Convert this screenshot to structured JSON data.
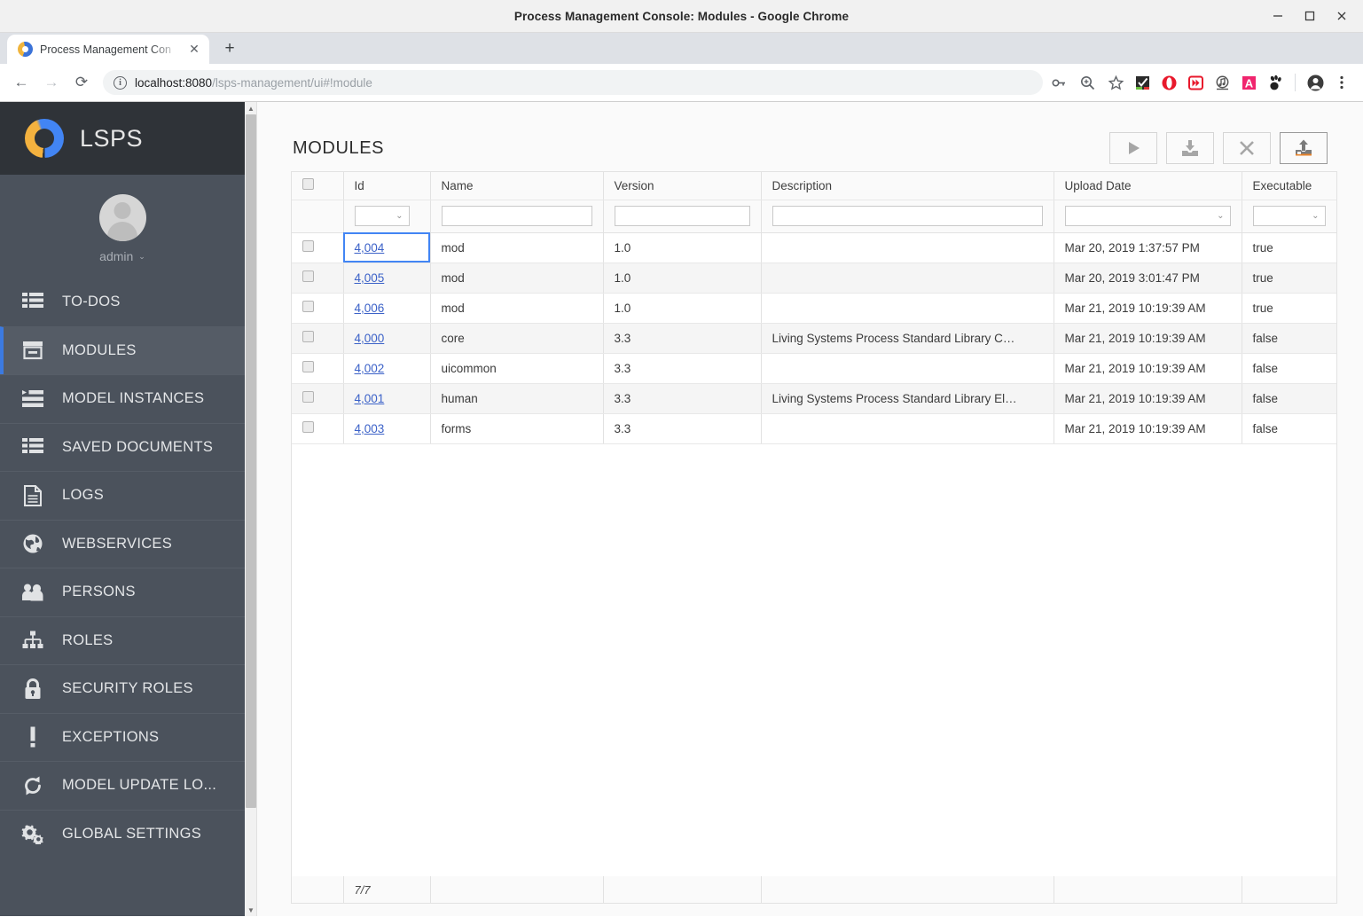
{
  "window": {
    "title": "Process Management Console: Modules - Google Chrome",
    "minimize_label": "–",
    "maximize_label": "□",
    "close_label": "✕"
  },
  "browser": {
    "tab": {
      "title": "Process Management Con",
      "close_label": "✕",
      "favicon": "lsps-favicon-icon"
    },
    "new_tab_label": "+",
    "nav": {
      "back_label": "←",
      "forward_label": "→",
      "reload_label": "⟳"
    },
    "omnibox": {
      "info_label": "i",
      "url_host": "localhost:8080",
      "url_path": "/lsps-management/ui#!module"
    },
    "omnibox_icons": [
      "key-icon",
      "zoom-icon",
      "star-icon"
    ],
    "extension_icons": [
      "checkbox-extension-icon",
      "opera-extension-icon",
      "forward-media-extension-icon",
      "music-extension-icon",
      "letter-a-extension-icon",
      "gnome-extension-icon"
    ],
    "profile_icon": "profile-avatar-icon",
    "menu_icon": "three-dot-menu-icon"
  },
  "sidebar": {
    "brand": "LSPS",
    "user": {
      "name": "admin",
      "caret": "⌄"
    },
    "items": [
      {
        "label": "TO-DOS",
        "icon": "list-icon",
        "active": false
      },
      {
        "label": "MODULES",
        "icon": "archive-box-icon",
        "active": true
      },
      {
        "label": "MODEL INSTANCES",
        "icon": "list-play-icon",
        "active": false
      },
      {
        "label": "SAVED DOCUMENTS",
        "icon": "list-icon",
        "active": false
      },
      {
        "label": "LOGS",
        "icon": "document-icon",
        "active": false
      },
      {
        "label": "WEBSERVICES",
        "icon": "globe-icon",
        "active": false
      },
      {
        "label": "PERSONS",
        "icon": "people-icon",
        "active": false
      },
      {
        "label": "ROLES",
        "icon": "hierarchy-icon",
        "active": false
      },
      {
        "label": "SECURITY ROLES",
        "icon": "lock-icon",
        "active": false
      },
      {
        "label": "EXCEPTIONS",
        "icon": "exclamation-icon",
        "active": false
      },
      {
        "label": "MODEL UPDATE LO...",
        "icon": "refresh-icon",
        "active": false
      },
      {
        "label": "GLOBAL SETTINGS",
        "icon": "gears-icon",
        "active": false
      }
    ]
  },
  "main": {
    "page_title": "MODULES",
    "toolbar": [
      {
        "name": "run-button",
        "icon": "play-icon",
        "enabled": false
      },
      {
        "name": "download-button",
        "icon": "download-icon",
        "enabled": false
      },
      {
        "name": "delete-button",
        "icon": "close-x-icon",
        "enabled": false
      },
      {
        "name": "upload-button",
        "icon": "upload-icon",
        "enabled": true
      }
    ],
    "table": {
      "columns": [
        "Id",
        "Name",
        "Version",
        "Description",
        "Upload Date",
        "Executable"
      ],
      "filters": {
        "id": "",
        "name": "",
        "version": "",
        "description": "",
        "upload_date": "",
        "executable": ""
      },
      "rows": [
        {
          "id": "4,004",
          "name": "mod",
          "version": "1.0",
          "description": "",
          "upload_date": "Mar 20, 2019 1:37:57 PM",
          "executable": "true",
          "focused": true
        },
        {
          "id": "4,005",
          "name": "mod",
          "version": "1.0",
          "description": "",
          "upload_date": "Mar 20, 2019 3:01:47 PM",
          "executable": "true",
          "focused": false
        },
        {
          "id": "4,006",
          "name": "mod",
          "version": "1.0",
          "description": "",
          "upload_date": "Mar 21, 2019 10:19:39 AM",
          "executable": "true",
          "focused": false
        },
        {
          "id": "4,000",
          "name": "core",
          "version": "3.3",
          "description": "Living Systems Process Standard Library C…",
          "upload_date": "Mar 21, 2019 10:19:39 AM",
          "executable": "false",
          "focused": false
        },
        {
          "id": "4,002",
          "name": "uicommon",
          "version": "3.3",
          "description": "",
          "upload_date": "Mar 21, 2019 10:19:39 AM",
          "executable": "false",
          "focused": false
        },
        {
          "id": "4,001",
          "name": "human",
          "version": "3.3",
          "description": "Living Systems Process Standard Library El…",
          "upload_date": "Mar 21, 2019 10:19:39 AM",
          "executable": "false",
          "focused": false
        },
        {
          "id": "4,003",
          "name": "forms",
          "version": "3.3",
          "description": "",
          "upload_date": "Mar 21, 2019 10:19:39 AM",
          "executable": "false",
          "focused": false
        }
      ],
      "footer_count": "7/7"
    }
  },
  "colors": {
    "sidebar_bg": "#4b525c",
    "sidebar_brand_bg": "#2f3338",
    "sidebar_active_bg": "#555c66",
    "accent_blue": "#3c7ae0",
    "link_blue": "#3c62c8",
    "logo_blue": "#4285f4",
    "logo_orange": "#f4b23f",
    "upload_accent": "#e8832a"
  }
}
